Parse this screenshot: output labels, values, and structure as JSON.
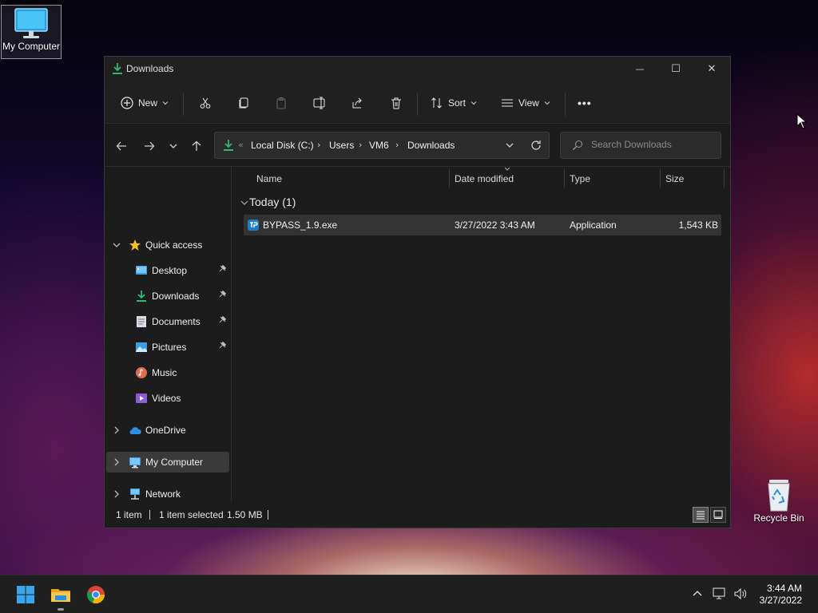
{
  "desktop": {
    "icons": [
      {
        "label": "My Computer",
        "icon": "monitor-icon"
      },
      {
        "label": "Recycle Bin",
        "icon": "recycle-bin-icon"
      }
    ]
  },
  "window": {
    "title": "Downloads",
    "controls": {
      "minimize": "—",
      "maximize": "☐",
      "close": "✕"
    }
  },
  "commandbar": {
    "new_label": "New",
    "sort_label": "Sort",
    "view_label": "View",
    "more_label": "•••",
    "icons": [
      "cut-icon",
      "copy-icon",
      "paste-icon",
      "rename-icon",
      "share-icon",
      "delete-icon"
    ]
  },
  "address": {
    "overflow": "«",
    "crumbs": [
      "Local Disk (C:)",
      "Users",
      "VM6",
      "Downloads"
    ],
    "separator": "›"
  },
  "search": {
    "placeholder": "Search Downloads"
  },
  "navpane": {
    "quick_access": "Quick access",
    "items": [
      {
        "label": "Desktop",
        "icon": "desktop-icon",
        "pinned": true
      },
      {
        "label": "Downloads",
        "icon": "downloads-icon",
        "pinned": true
      },
      {
        "label": "Documents",
        "icon": "documents-icon",
        "pinned": true
      },
      {
        "label": "Pictures",
        "icon": "pictures-icon",
        "pinned": true
      },
      {
        "label": "Music",
        "icon": "music-icon",
        "pinned": false
      },
      {
        "label": "Videos",
        "icon": "videos-icon",
        "pinned": false
      }
    ],
    "onedrive": "OneDrive",
    "my_computer": "My Computer",
    "network": "Network"
  },
  "columns": {
    "name": "Name",
    "date": "Date modified",
    "type": "Type",
    "size": "Size"
  },
  "groups": [
    {
      "header": "Today (1)",
      "files": [
        {
          "name": "BYPASS_1.9.exe",
          "date": "3/27/2022 3:43 AM",
          "type": "Application",
          "size": "1,543 KB"
        }
      ]
    }
  ],
  "status": {
    "count": "1 item",
    "selected": "1 item selected",
    "size": "1.50 MB"
  },
  "taskbar": {
    "apps": [
      "start-icon",
      "file-explorer-icon",
      "chrome-icon"
    ],
    "time": "3:44 AM",
    "date": "3/27/2022"
  },
  "colors": {
    "accent_green": "#2fb87a",
    "folder_yellow": "#f2c14e",
    "window_bg": "#1c1c1c"
  }
}
